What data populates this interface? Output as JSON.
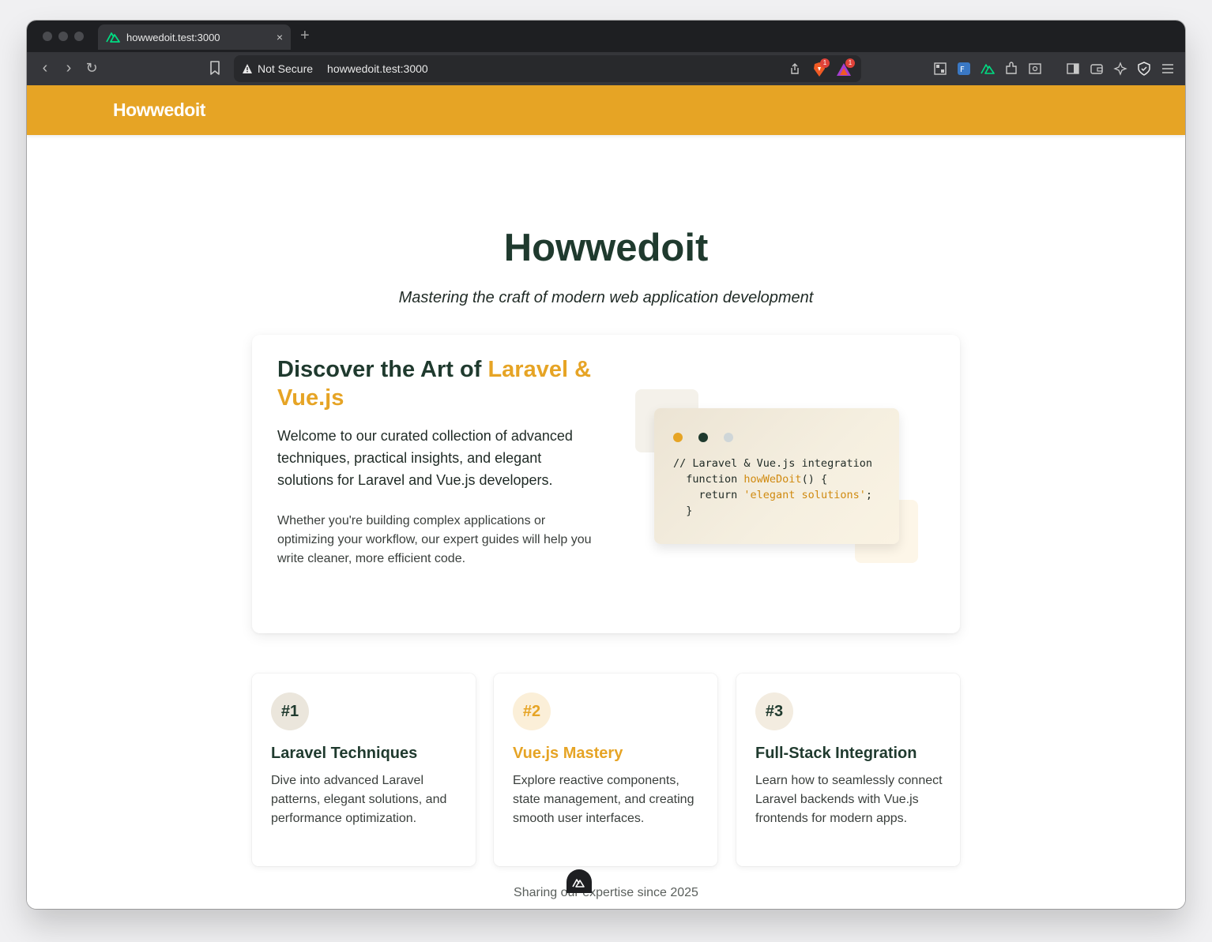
{
  "browser": {
    "tab_title": "howwedoit.test:3000",
    "tab_close": "×",
    "new_tab": "+",
    "security_label": "Not Secure",
    "url": "howwedoit.test:3000",
    "shields_badge": "1",
    "rewards_badge": "1"
  },
  "site": {
    "brand": "Howwedoit",
    "brand_color": "#e6a425"
  },
  "hero": {
    "title": "Howwedoit",
    "subtitle": "Mastering the craft of modern web application development"
  },
  "feature": {
    "title_prefix": "Discover the Art of ",
    "title_accent": "Laravel & Vue.js",
    "paragraph1": "Welcome to our curated collection of advanced techniques, practical insights, and elegant solutions for Laravel and Vue.js developers.",
    "paragraph2": "Whether you're building complex applications or optimizing your workflow, our expert guides will help you write cleaner, more efficient code.",
    "code": {
      "line1": "// Laravel & Vue.js integration",
      "line2_kw": "  function ",
      "line2_fn": "howWeDoit",
      "line2_end": "() {",
      "line3_kw": "    return ",
      "line3_str": "'elegant solutions'",
      "line3_end": ";",
      "line4": "  }"
    }
  },
  "cards": [
    {
      "number": "#1",
      "title": "Laravel Techniques",
      "description": "Dive into advanced Laravel patterns, elegant solutions, and performance optimization."
    },
    {
      "number": "#2",
      "title": "Vue.js Mastery",
      "description": "Explore reactive components, state management, and creating smooth user interfaces."
    },
    {
      "number": "#3",
      "title": "Full-Stack Integration",
      "description": "Learn how to seamlessly connect Laravel backends with Vue.js frontends for modern apps."
    }
  ],
  "footer": {
    "text": "Sharing our expertise since 2025"
  }
}
